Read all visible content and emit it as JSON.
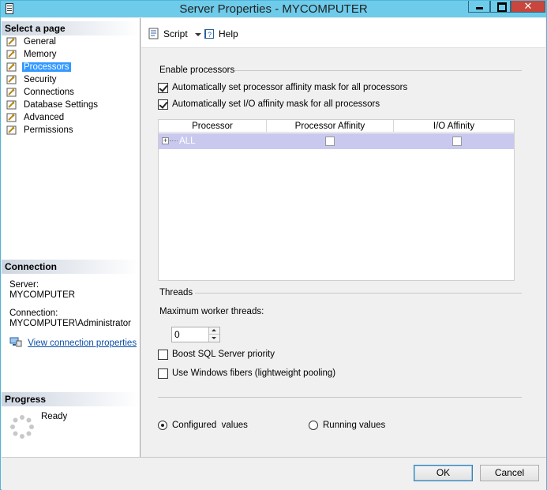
{
  "window": {
    "title": "Server Properties - MYCOMPUTER",
    "close_glyph": "✕"
  },
  "left": {
    "select_header": "Select a page",
    "pages": [
      {
        "label": "General",
        "icon": "wrench-page-icon"
      },
      {
        "label": "Memory",
        "icon": "wrench-page-icon"
      },
      {
        "label": "Processors",
        "icon": "wrench-page-icon",
        "selected": true
      },
      {
        "label": "Security",
        "icon": "wrench-page-icon"
      },
      {
        "label": "Connections",
        "icon": "wrench-page-icon"
      },
      {
        "label": "Database Settings",
        "icon": "wrench-page-icon"
      },
      {
        "label": "Advanced",
        "icon": "wrench-page-icon"
      },
      {
        "label": "Permissions",
        "icon": "wrench-page-icon"
      }
    ],
    "connection_header": "Connection",
    "server_label": "Server:",
    "server_value": "MYCOMPUTER",
    "connection_label": "Connection:",
    "connection_value": "MYCOMPUTER\\Administrator",
    "view_props_link": "View connection properties",
    "progress_header": "Progress",
    "progress_status": "Ready"
  },
  "toolbar": {
    "script_label": "Script",
    "help_label": "Help"
  },
  "processors": {
    "enable_group": "Enable processors",
    "auto_processor_affinity": {
      "label": "Automatically set processor affinity mask for all processors",
      "checked": true
    },
    "auto_io_affinity": {
      "label": "Automatically set I/O affinity mask for all processors",
      "checked": true
    },
    "grid": {
      "columns": [
        "Processor",
        "Processor Affinity",
        "I/O Affinity"
      ],
      "rows": [
        {
          "processor": "ALL",
          "processor_affinity": false,
          "io_affinity": false,
          "expander": "+"
        }
      ]
    },
    "threads_group": "Threads",
    "max_worker_label": "Maximum worker threads:",
    "max_worker_value": "0",
    "boost_priority": {
      "label": "Boost SQL Server priority",
      "checked": false
    },
    "fibers": {
      "label": "Use Windows fibers (lightweight pooling)",
      "checked": false
    },
    "configured_label": "Configured  values",
    "running_label": "Running values",
    "selected_values": "configured"
  },
  "buttons": {
    "ok": "OK",
    "cancel": "Cancel"
  },
  "colors": {
    "titlebar": "#6ecbea",
    "selection": "#3399ff",
    "grid_row": "#c9c9f0",
    "close": "#c9463d"
  }
}
